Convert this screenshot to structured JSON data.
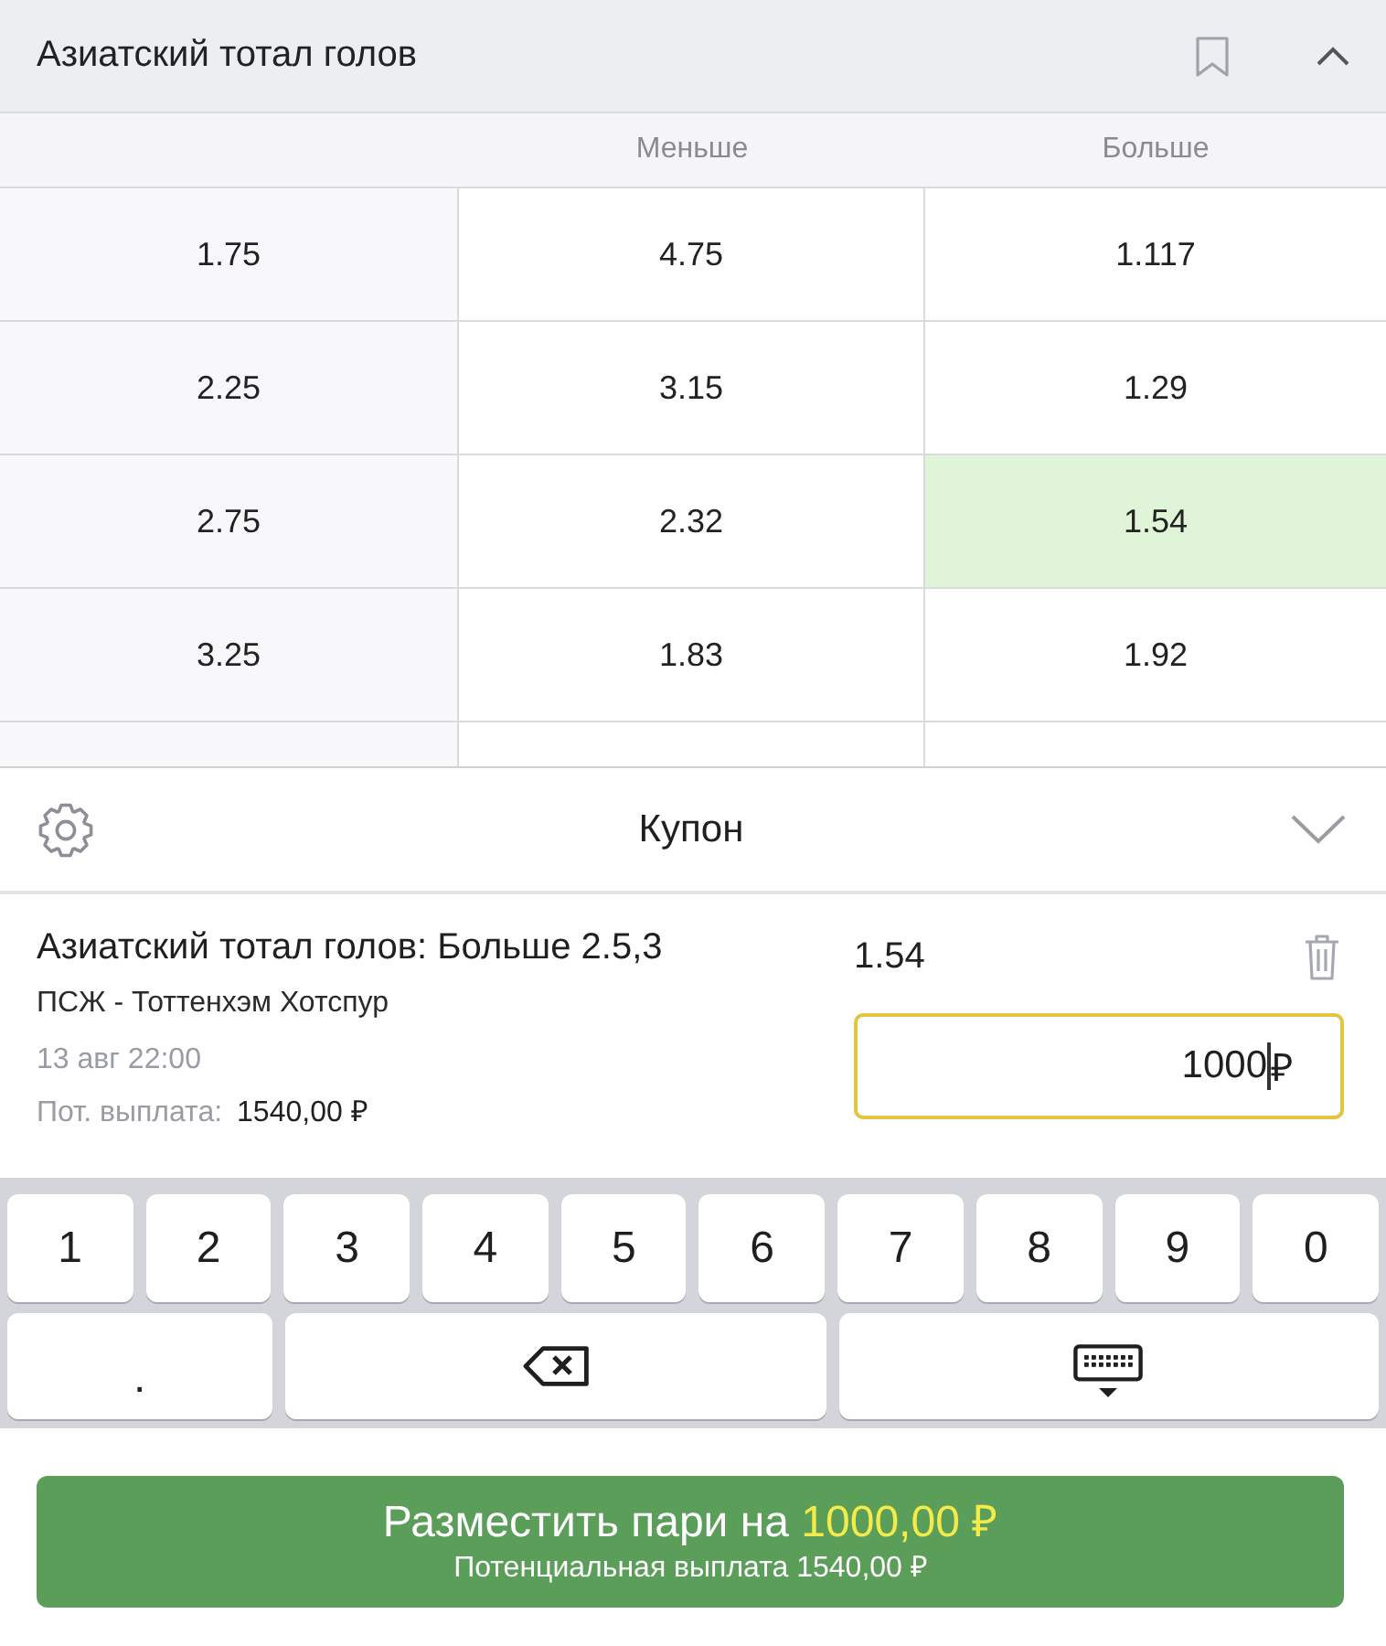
{
  "market": {
    "title": "Азиатский тотал голов"
  },
  "table": {
    "columns": [
      {
        "label": "Меньше"
      },
      {
        "label": "Больше"
      }
    ],
    "rows": [
      {
        "line": "1.75",
        "odds": [
          {
            "value": "4.75",
            "selected": false
          },
          {
            "value": "1.117",
            "selected": false
          }
        ]
      },
      {
        "line": "2.25",
        "odds": [
          {
            "value": "3.15",
            "selected": false
          },
          {
            "value": "1.29",
            "selected": false
          }
        ]
      },
      {
        "line": "2.75",
        "odds": [
          {
            "value": "2.32",
            "selected": false
          },
          {
            "value": "1.54",
            "selected": true
          }
        ]
      },
      {
        "line": "3.25",
        "odds": [
          {
            "value": "1.83",
            "selected": false
          },
          {
            "value": "1.92",
            "selected": false
          }
        ]
      }
    ]
  },
  "coupon": {
    "title": "Купон",
    "bet": {
      "title": "Азиатский тотал голов: Больше 2.5,3",
      "odds": "1.54",
      "match": "ПСЖ - Тоттенхэм Хотспур",
      "datetime": "13 авг 22:00",
      "payout_label": "Пот. выплата:",
      "payout": "1540,00 ₽",
      "stake": {
        "value": "1000",
        "currency": "₽"
      }
    }
  },
  "keyboard": {
    "rows": [
      [
        {
          "kind": "char",
          "label": "1"
        },
        {
          "kind": "char",
          "label": "2"
        },
        {
          "kind": "char",
          "label": "3"
        },
        {
          "kind": "char",
          "label": "4"
        },
        {
          "kind": "char",
          "label": "5"
        },
        {
          "kind": "char",
          "label": "6"
        },
        {
          "kind": "char",
          "label": "7"
        },
        {
          "kind": "char",
          "label": "8"
        },
        {
          "kind": "char",
          "label": "9"
        },
        {
          "kind": "char",
          "label": "0"
        }
      ],
      [
        {
          "kind": "char",
          "label": "."
        },
        {
          "kind": "backspace"
        },
        {
          "kind": "hide"
        }
      ]
    ]
  },
  "place_button": {
    "label": "Разместить пари на",
    "amount": "1000,00 ₽",
    "subtitle": "Потенциальная выплата 1540,00 ₽"
  }
}
